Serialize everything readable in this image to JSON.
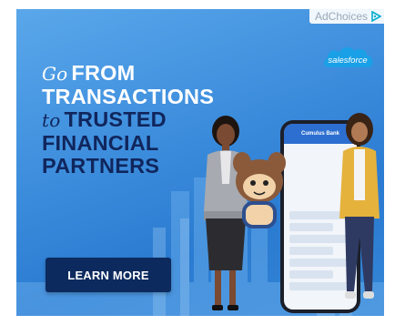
{
  "adchoices": {
    "label": "AdChoices"
  },
  "brand": {
    "logo_text": "salesforce"
  },
  "headline": {
    "line1_script": "Go",
    "line1_bold": "FROM",
    "line2": "TRANSACTIONS",
    "line3_script": "to",
    "line3_bold": "TRUSTED",
    "line4": "FINANCIAL",
    "line5": "PARTNERS"
  },
  "cta": {
    "label": "LEARN MORE"
  },
  "phone": {
    "app_title": "Cumulus Bank"
  },
  "colors": {
    "background": "#3f8fde",
    "dark_text": "#10265c",
    "cta_background": "#0c2a5e",
    "logo_cloud": "#1aa0e6"
  }
}
